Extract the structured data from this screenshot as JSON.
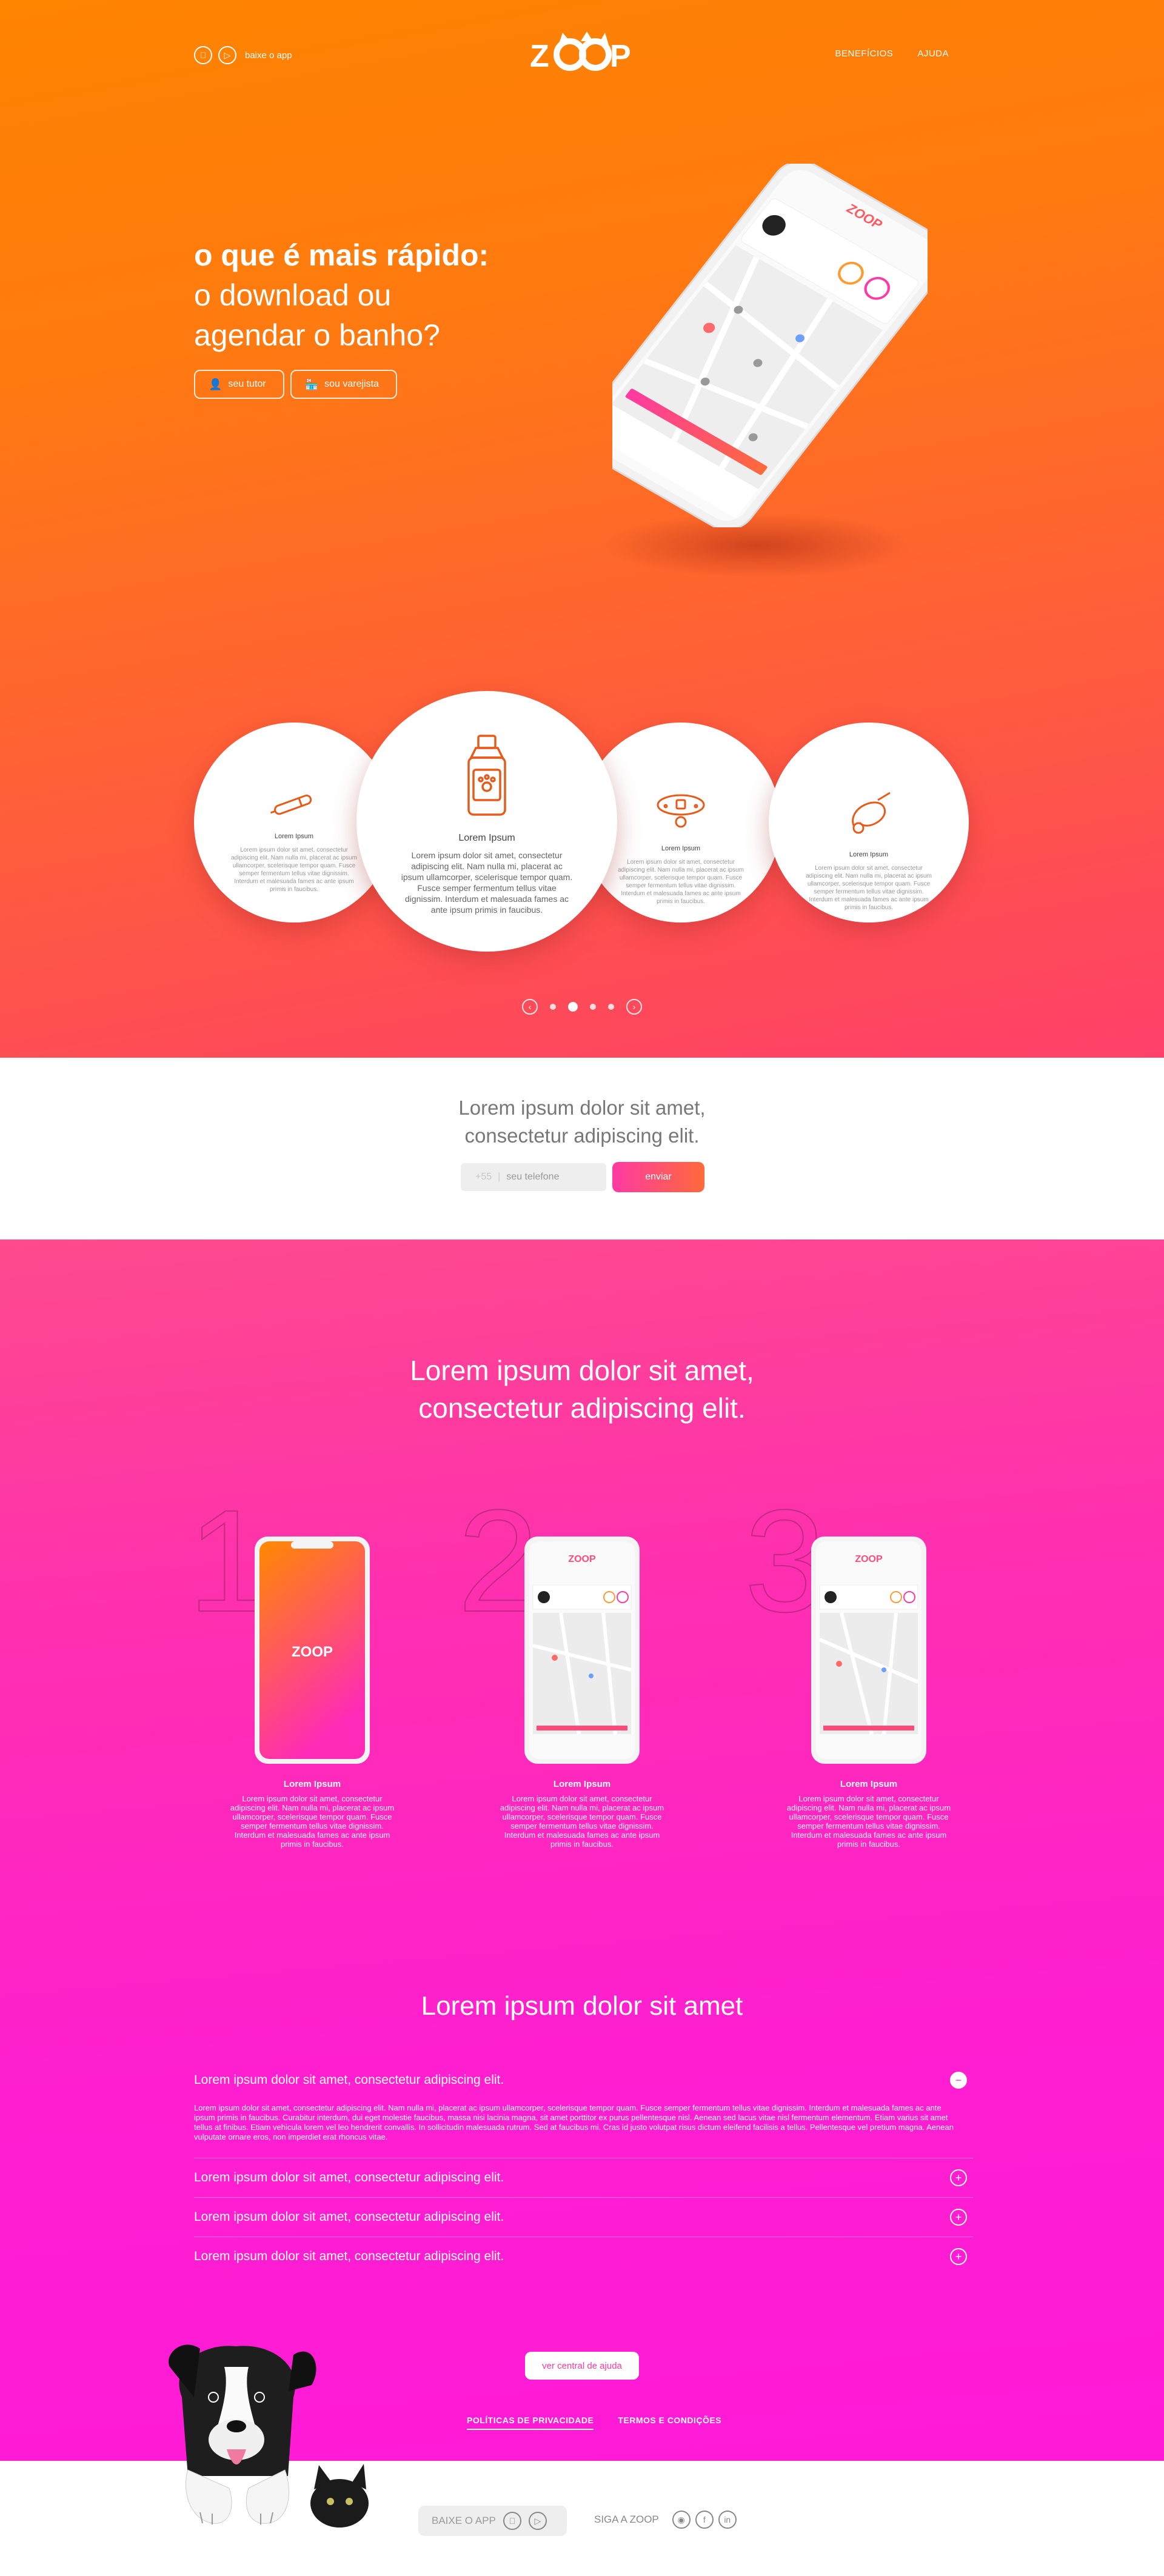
{
  "header": {
    "store_label": "baixe o app",
    "nav": [
      "BENEFÍCIOS",
      "AJUDA"
    ]
  },
  "hero": {
    "title_bold": "o que é mais rápido:",
    "title_line2": "o download ou",
    "title_line3": "agendar o banho?",
    "btn_tutor": "seu tutor",
    "btn_retailer": "sou varejista"
  },
  "carousel": {
    "items": [
      {
        "icon": "thermometer-icon",
        "title": "Lorem Ipsum",
        "text": "Lorem ipsum dolor sit amet, consectetur adipiscing elit. Nam nulla mi, placerat ac ipsum ullamcorper, scelerisque tempor quam. Fusce semper fermentum tellus vitae dignissim. Interdum et malesuada fames ac ante ipsum primis in faucibus."
      },
      {
        "icon": "shampoo-bottle-icon",
        "title": "Lorem Ipsum",
        "text": "Lorem ipsum dolor sit amet, consectetur adipiscing elit. Nam nulla mi, placerat ac ipsum ullamcorper, scelerisque tempor quam. Fusce semper fermentum tellus vitae dignissim. Interdum et malesuada fames ac ante ipsum primis in faucibus."
      },
      {
        "icon": "collar-icon",
        "title": "Lorem Ipsum",
        "text": "Lorem ipsum dolor sit amet, consectetur adipiscing elit. Nam nulla mi, placerat ac ipsum ullamcorper, scelerisque tempor quam. Fusce semper fermentum tellus vitae dignissim. Interdum et malesuada fames ac ante ipsum primis in faucibus."
      },
      {
        "icon": "leash-icon",
        "title": "Lorem Ipsum",
        "text": "Lorem ipsum dolor sit amet, consectetur adipiscing elit. Nam nulla mi, placerat ac ipsum ullamcorper, scelerisque tempor quam. Fusce semper fermentum tellus vitae dignissim. Interdum et malesuada fames ac ante ipsum primis in faucibus."
      }
    ],
    "dots": 4,
    "active_dot": 1
  },
  "signup": {
    "line1": "Lorem ipsum dolor sit amet,",
    "line2": "consectetur adipiscing elit.",
    "country_code": "+55",
    "placeholder": "seu telefone",
    "send_label": "enviar"
  },
  "steps": {
    "line1": "Lorem ipsum dolor sit amet,",
    "line2": "consectetur adipiscing elit.",
    "items": [
      {
        "num": "1",
        "title": "Lorem Ipsum",
        "text": "Lorem ipsum dolor sit amet, consectetur adipiscing elit. Nam nulla mi, placerat ac ipsum ullamcorper, scelerisque tempor quam. Fusce semper fermentum tellus vitae dignissim. Interdum et malesuada fames ac ante ipsum primis in faucibus."
      },
      {
        "num": "2",
        "title": "Lorem Ipsum",
        "text": "Lorem ipsum dolor sit amet, consectetur adipiscing elit. Nam nulla mi, placerat ac ipsum ullamcorper, scelerisque tempor quam. Fusce semper fermentum tellus vitae dignissim. Interdum et malesuada fames ac ante ipsum primis in faucibus."
      },
      {
        "num": "3",
        "title": "Lorem Ipsum",
        "text": "Lorem ipsum dolor sit amet, consectetur adipiscing elit. Nam nulla mi, placerat ac ipsum ullamcorper, scelerisque tempor quam. Fusce semper fermentum tellus vitae dignissim. Interdum et malesuada fames ac ante ipsum primis in faucibus."
      }
    ]
  },
  "faq": {
    "title": "Lorem ipsum dolor sit amet",
    "items": [
      {
        "q": "Lorem ipsum dolor sit amet, consectetur adipiscing elit.",
        "a": "Lorem ipsum dolor sit amet, consectetur adipiscing elit. Nam nulla mi, placerat ac ipsum ullamcorper, scelerisque tempor quam. Fusce semper fermentum tellus vitae dignissim. Interdum et malesuada fames ac ante ipsum primis in faucibus. Curabitur interdum, dui eget molestie faucibus, massa nisi lacinia magna, sit amet porttitor ex purus pellentesque nisl. Aenean sed lacus vitae nisl fermentum elementum. Etiam varius sit amet tellus at finibus. Etiam vehicula lorem vel leo hendrerit convallis. In sollicitudin malesuada rutrum. Sed at faucibus mi. Cras id justo volutpat risus dictum eleifend facilisis a tellus. Pellentesque vel pretium magna. Aenean vulputate ornare eros, non imperdiet erat rhoncus vitae.",
        "open": true
      },
      {
        "q": "Lorem ipsum dolor sit amet, consectetur adipiscing elit.",
        "open": false
      },
      {
        "q": "Lorem ipsum dolor sit amet, consectetur adipiscing elit.",
        "open": false
      },
      {
        "q": "Lorem ipsum dolor sit amet, consectetur adipiscing elit.",
        "open": false
      }
    ],
    "help_label": "ver central de ajuda"
  },
  "legal": {
    "privacy": "POLÍTICAS DE PRIVACIDADE",
    "terms": "TERMOS E CONDIÇÕES"
  },
  "footer": {
    "app_label": "BAIXE O APP",
    "follow_label": "SIGA A ZOOP"
  },
  "colors": {
    "orange": "#ff8400",
    "pink": "#ff1fd0",
    "accent_gradient_start": "#ff3aa3",
    "accent_gradient_end": "#ff6a3a"
  }
}
